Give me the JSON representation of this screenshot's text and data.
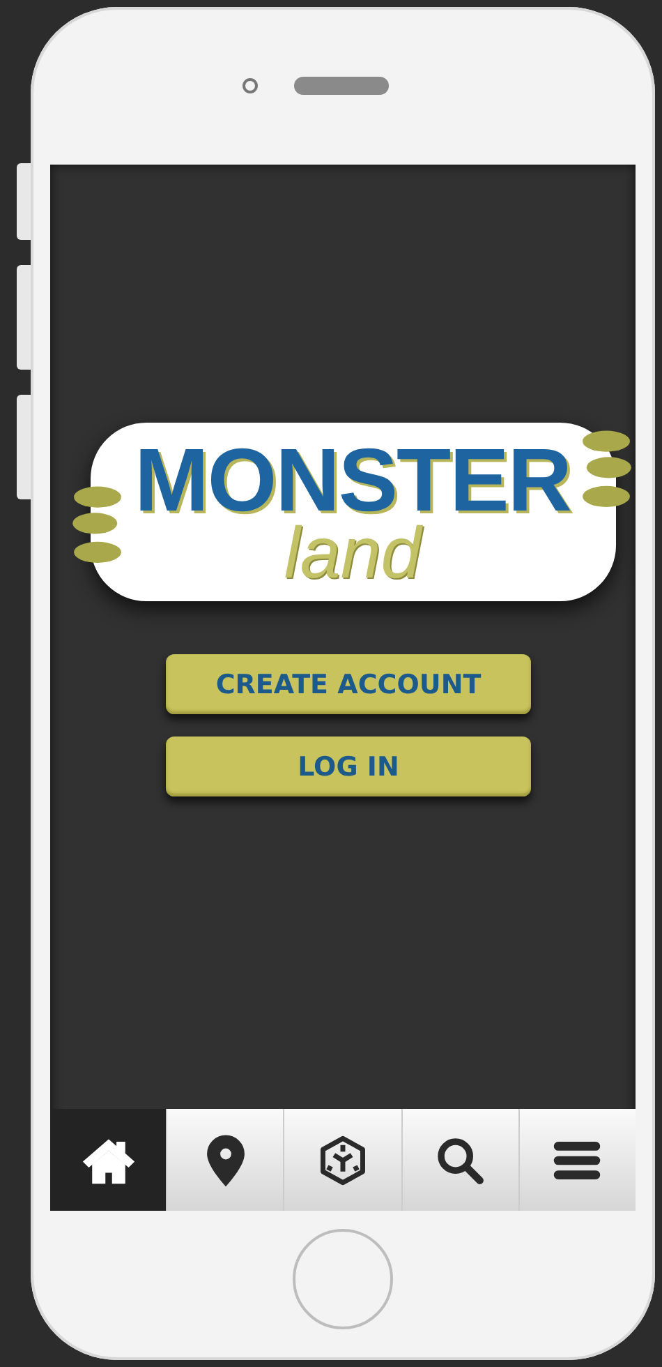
{
  "logo": {
    "title": "MONSTER",
    "subtitle": "land"
  },
  "buttons": [
    {
      "label": "CREATE ACCOUNT"
    },
    {
      "label": "LOG IN"
    }
  ],
  "tab_bar": [
    {
      "kind": "home",
      "selected": true
    },
    {
      "kind": "location",
      "selected": false
    },
    {
      "kind": "cube",
      "selected": false
    },
    {
      "kind": "search",
      "selected": false
    },
    {
      "kind": "menu",
      "selected": false
    }
  ]
}
